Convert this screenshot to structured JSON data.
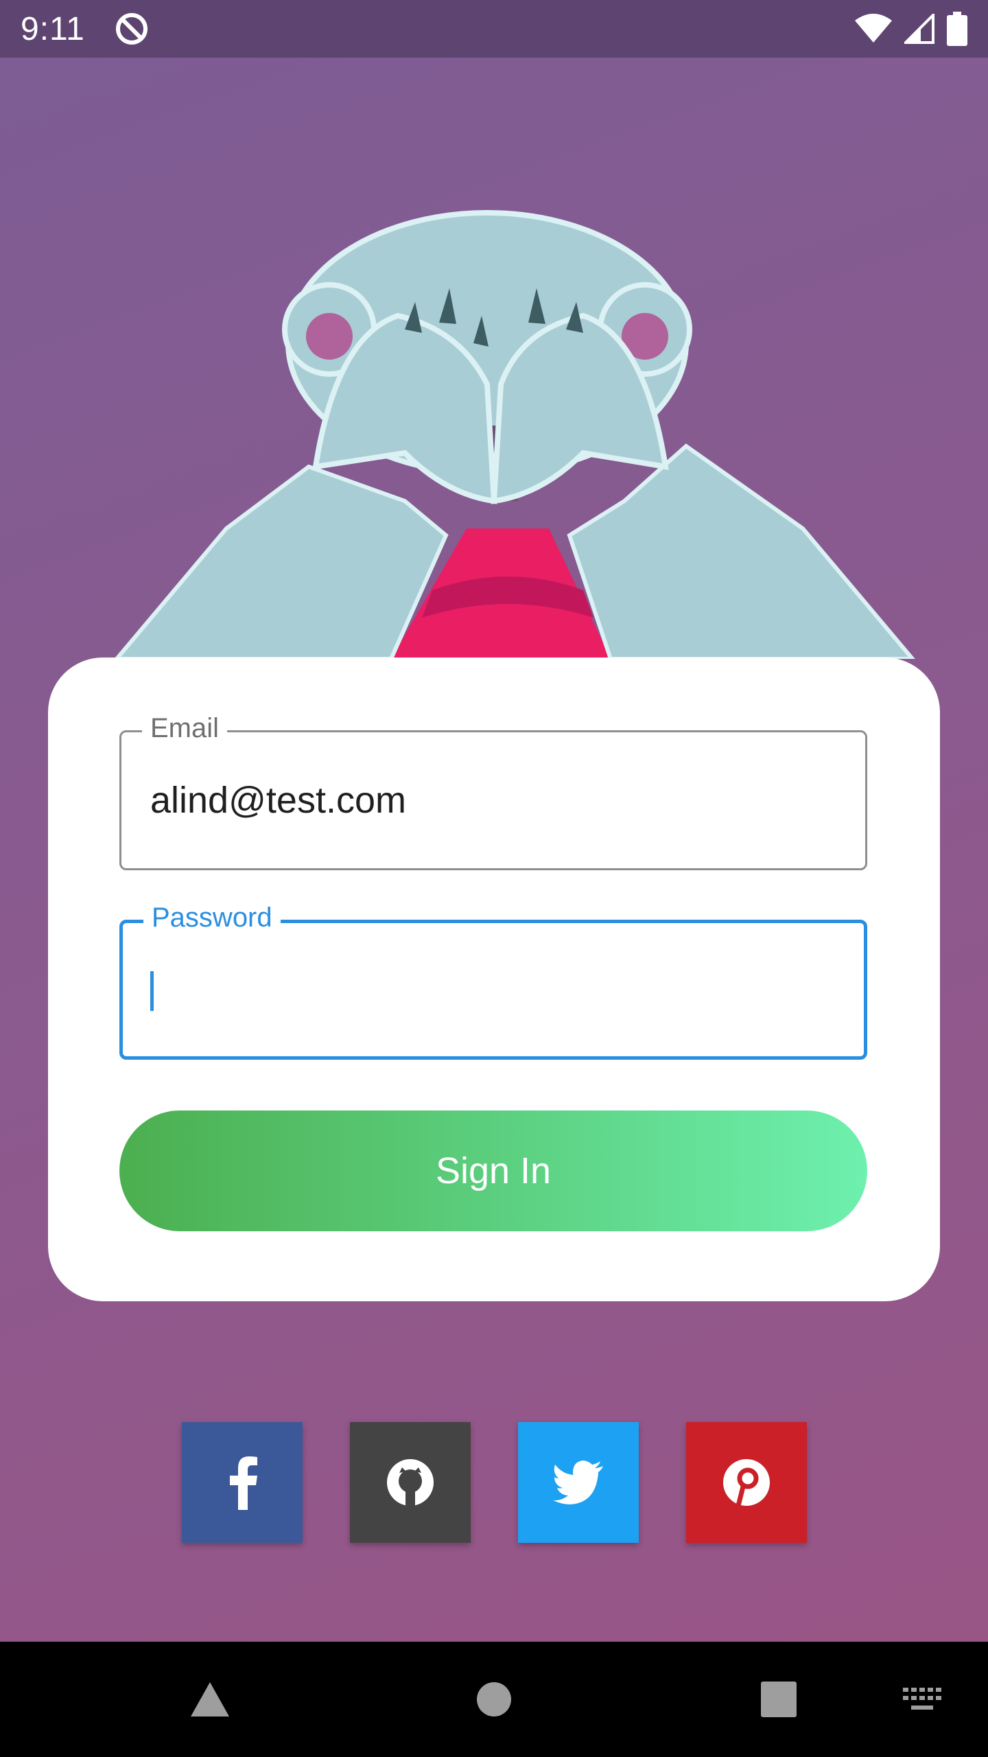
{
  "status_bar": {
    "time": "9:11",
    "icons": [
      "data-saver-icon",
      "wifi-icon",
      "signal-icon",
      "battery-icon"
    ]
  },
  "illustration": {
    "name": "bear-covering-eyes"
  },
  "login_form": {
    "email": {
      "label": "Email",
      "value": "alind@test.com"
    },
    "password": {
      "label": "Password",
      "value": ""
    },
    "signin_label": "Sign In"
  },
  "social_buttons": [
    {
      "name": "facebook",
      "icon": "facebook-icon",
      "color": "#3b5998"
    },
    {
      "name": "github",
      "icon": "github-icon",
      "color": "#444444"
    },
    {
      "name": "twitter",
      "icon": "twitter-icon",
      "color": "#1da1f2"
    },
    {
      "name": "pinterest",
      "icon": "pinterest-icon",
      "color": "#cb2027"
    }
  ],
  "nav_bar": {
    "buttons": [
      "back-icon",
      "home-icon",
      "recents-icon",
      "keyboard-icon"
    ]
  },
  "colors": {
    "accent": "#2a8fe0",
    "status_bar": "#5e4470",
    "background_top": "#7c5d94",
    "background_bottom": "#9a5585",
    "signin_start": "#4caf50",
    "signin_end": "#6ef0ae"
  }
}
